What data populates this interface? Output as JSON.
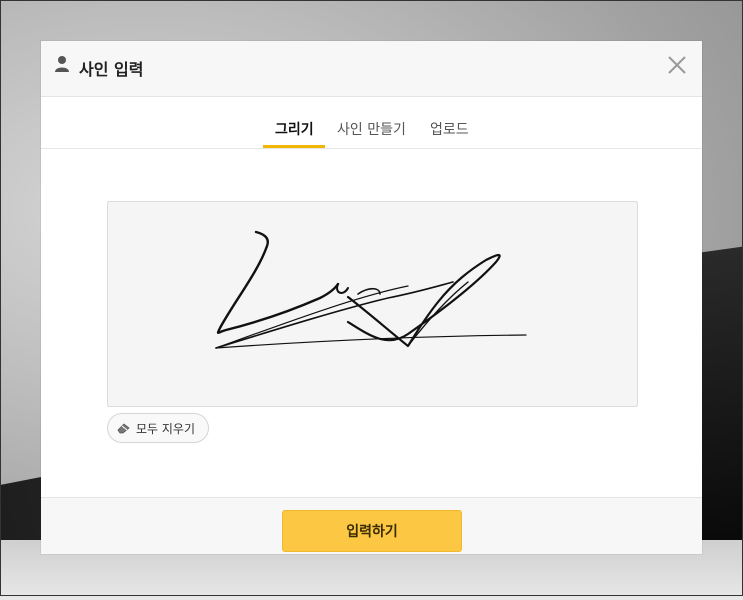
{
  "dialog": {
    "title": "사인 입력",
    "title_icon": "user-icon",
    "close_icon": "close-icon"
  },
  "tabs": [
    {
      "label": "그리기",
      "active": true
    },
    {
      "label": "사인 만들기",
      "active": false
    },
    {
      "label": "업로드",
      "active": false
    }
  ],
  "canvas": {
    "content": "hand-drawn signature"
  },
  "clear_button": {
    "label": "모두 지우기",
    "icon": "eraser-icon"
  },
  "footer": {
    "submit_label": "입력하기"
  },
  "colors": {
    "accent": "#f2b705",
    "submit_bg": "#fcc843"
  }
}
